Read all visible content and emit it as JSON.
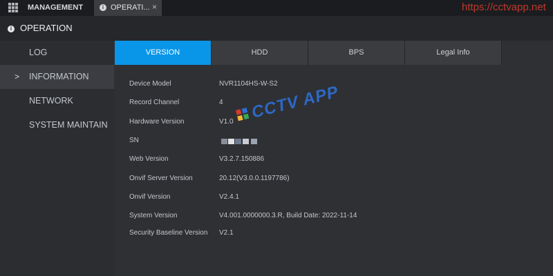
{
  "topbar": {
    "management_label": "MANAGEMENT",
    "operation_tab_label": "OPERATI...",
    "close_glyph": "×",
    "watermark_url": "https://cctvapp.net"
  },
  "header": {
    "title": "OPERATION"
  },
  "sidebar": {
    "items": [
      {
        "label": "LOG",
        "active": false
      },
      {
        "label": "INFORMATION",
        "active": true
      },
      {
        "label": "NETWORK",
        "active": false
      },
      {
        "label": "SYSTEM MAINTAIN",
        "active": false
      }
    ],
    "active_glyph": ">"
  },
  "subtabs": [
    {
      "label": "VERSION",
      "active": true
    },
    {
      "label": "HDD",
      "active": false
    },
    {
      "label": "BPS",
      "active": false
    },
    {
      "label": "Legal Info",
      "active": false
    }
  ],
  "info": {
    "rows": [
      {
        "key": "Device Model",
        "value": "NVR1104HS-W-S2"
      },
      {
        "key": "Record Channel",
        "value": "4"
      },
      {
        "key": "Hardware Version",
        "value": "V1.0"
      },
      {
        "key": "SN",
        "value": ""
      },
      {
        "key": "Web Version",
        "value": "V3.2.7.150886"
      },
      {
        "key": "Onvif Server Version",
        "value": "20.12(V3.0.0.1197786)"
      },
      {
        "key": "Onvif Version",
        "value": "V2.4.1"
      },
      {
        "key": "System Version",
        "value": "V4.001.0000000.3.R, Build Date: 2022-11-14"
      },
      {
        "key": "Security Baseline Version",
        "value": "V2.1"
      }
    ]
  },
  "watermark": {
    "text": "CCTV APP"
  },
  "colors": {
    "accent": "#0a96e8",
    "watermark_blue": "#2d6fd6",
    "url_red": "#c0392b"
  },
  "icons": {
    "apps": "apps-grid-icon",
    "info": "info-icon",
    "close": "close-icon",
    "chevron": "chevron-right-icon"
  }
}
